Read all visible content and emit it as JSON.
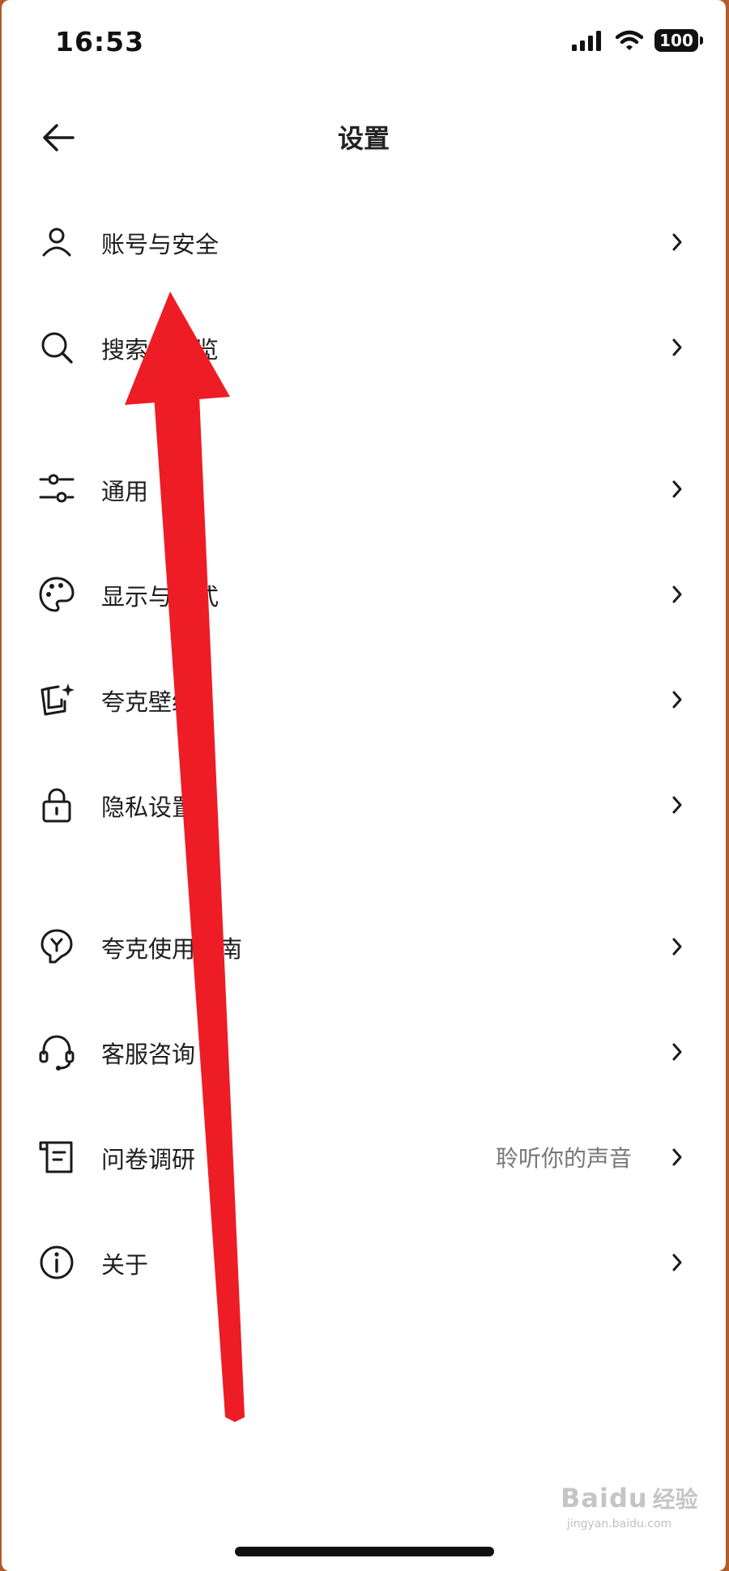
{
  "status_bar": {
    "time": "16:53",
    "battery": "100",
    "icons": [
      "signal-icon",
      "wifi-icon",
      "battery-icon"
    ]
  },
  "header": {
    "title": "设置",
    "back_icon": "arrow-left-icon"
  },
  "settings": {
    "items": [
      {
        "label": "账号与安全",
        "icon": "user-icon"
      },
      {
        "label": "搜索与浏览",
        "icon": "search-icon"
      },
      {
        "label": "通用",
        "icon": "sliders-icon"
      },
      {
        "label": "显示与样式",
        "icon": "palette-icon"
      },
      {
        "label": "夸克壁纸",
        "icon": "wallpaper-icon"
      },
      {
        "label": "隐私设置",
        "icon": "lock-icon"
      },
      {
        "label": "夸克使用指南",
        "icon": "lightbulb-icon"
      },
      {
        "label": "客服咨询",
        "icon": "headset-icon"
      },
      {
        "label": "问卷调研",
        "hint": "聆听你的声音",
        "icon": "survey-icon"
      },
      {
        "label": "关于",
        "icon": "info-icon"
      }
    ]
  },
  "annotation": {
    "color": "#ee1c25",
    "icon": "red-arrow-annotation"
  },
  "watermark": {
    "brand": "Bai",
    "brand_suffix": "du",
    "cn": "经验",
    "url": "jingyan.baidu.com"
  }
}
